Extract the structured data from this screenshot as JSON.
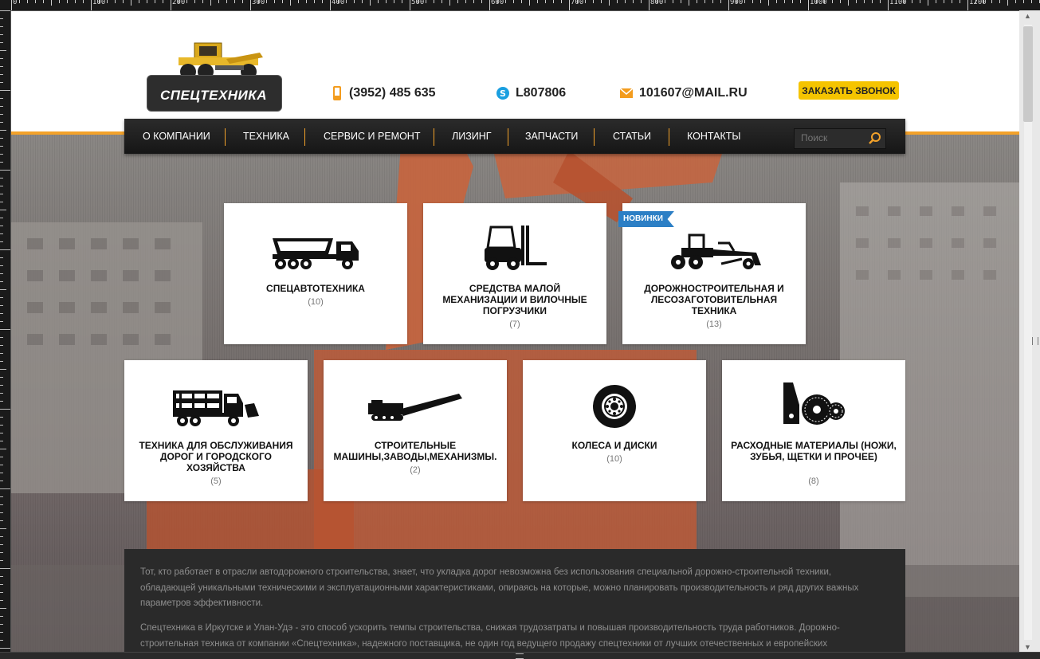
{
  "ruler": {
    "labels": [
      "0",
      "100",
      "200",
      "300",
      "400",
      "500",
      "600",
      "700",
      "800",
      "900",
      "1000",
      "1100",
      "1200"
    ]
  },
  "header": {
    "logo_text": "СПЕЦТЕХНИКА",
    "phone": "(3952) 485 635",
    "skype": "L807806",
    "email": "101607@MAIL.RU",
    "callback_label": "ЗАКАЗАТЬ ЗВОНОК"
  },
  "nav": {
    "items": [
      "О КОМПАНИИ",
      "ТЕХНИКА",
      "СЕРВИС И РЕМОНТ",
      "ЛИЗИНГ",
      "ЗАПЧАСТИ",
      "СТАТЬИ",
      "КОНТАКТЫ"
    ],
    "search_placeholder": "Поиск"
  },
  "categories": [
    {
      "title": "СПЕЦАВТОТЕХНИКА",
      "count": "(10)",
      "icon": "dump-truck-icon"
    },
    {
      "title": "СРЕДСТВА МАЛОЙ МЕХАНИЗАЦИИ И ВИЛОЧНЫЕ ПОГРУЗЧИКИ",
      "count": "(7)",
      "icon": "forklift-icon"
    },
    {
      "title": "ДОРОЖНОСТРОИТЕЛЬНАЯ И ЛЕСОЗАГОТОВИТЕЛЬНАЯ ТЕХНИКА",
      "count": "(13)",
      "icon": "grader-icon",
      "badge": "НОВИНКИ"
    },
    {
      "title": "ТЕХНИКА ДЛЯ ОБСЛУЖИВАНИЯ ДОРОГ И ГОРОДСКОГО ХОЗЯЙСТВА",
      "count": "(5)",
      "icon": "road-service-truck-icon"
    },
    {
      "title": "СТРОИТЕЛЬНЫЕ МАШИНЫ,ЗАВОДЫ,МЕХАНИЗМЫ.",
      "count": "(2)",
      "icon": "conveyor-icon"
    },
    {
      "title": "КОЛЕСА И ДИСКИ",
      "count": "(10)",
      "icon": "wheel-icon"
    },
    {
      "title": "РАСХОДНЫЕ МАТЕРИАЛЫ (НОЖИ, ЗУБЬЯ, ЩЕТКИ И ПРОЧЕЕ)",
      "count": "(8)",
      "icon": "blades-brushes-icon"
    }
  ],
  "about": {
    "p1": "Тот, кто работает в отрасли автодорожного строительства, знает, что укладка дорог невозможна без использования специальной дорожно-строительной техники, обладающей уникальными техническими и эксплуатационными характеристиками, опираясь на которые, можно планировать производительность и ряд других важных параметров эффективности.",
    "p2": "Спецтехника в Иркутске и Улан-Удэ - это способ ускорить темпы строительства, снижая трудозатраты и повышая производительность труда работников. Дорожно-строительная техника от компании «Спецтехника», надежного поставщика, не один год ведущего продажу спецтехники от лучших отечественных и европейских"
  },
  "colors": {
    "accent": "#f3a22a",
    "callback": "#f5c400",
    "badge": "#2c7fc5",
    "nav": "#1f1f1f"
  }
}
